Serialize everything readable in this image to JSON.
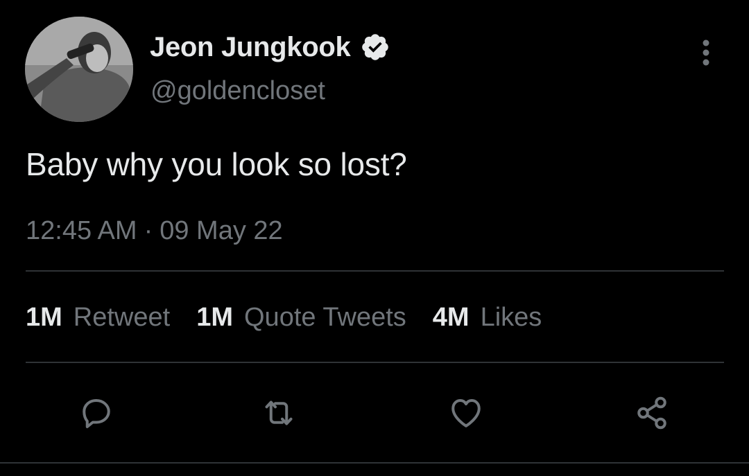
{
  "author": {
    "display_name": "Jeon Jungkook",
    "verified": true,
    "handle": "@goldencloset",
    "avatar": "avatar-photo"
  },
  "tweet": {
    "text": "Baby why you look so lost?",
    "time": "12:45 AM",
    "separator": "·",
    "date": "09 May 22"
  },
  "stats": [
    {
      "count": "1M",
      "label": "Retweet"
    },
    {
      "count": "1M",
      "label": "Quote Tweets"
    },
    {
      "count": "4M",
      "label": "Likes"
    }
  ],
  "actions": [
    {
      "icon": "reply-icon"
    },
    {
      "icon": "retweet-icon"
    },
    {
      "icon": "like-icon"
    },
    {
      "icon": "share-icon"
    }
  ],
  "menu": {
    "icon": "more-vertical-icon"
  },
  "colors": {
    "background": "#000000",
    "primary_text": "#e7e9ea",
    "secondary_text": "#71767b",
    "divider": "#2f3336"
  }
}
